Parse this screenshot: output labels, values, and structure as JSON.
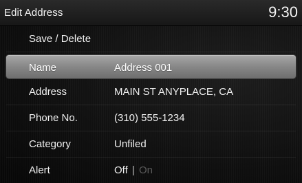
{
  "header": {
    "title": "Edit Address",
    "clock": "9:30"
  },
  "menu": {
    "save_delete": "Save / Delete",
    "rows": [
      {
        "label": "Name",
        "value": "Address 001"
      },
      {
        "label": "Address",
        "value": "MAIN ST ANYPLACE, CA"
      },
      {
        "label": "Phone No.",
        "value": "(310) 555-1234"
      },
      {
        "label": "Category",
        "value": "Unfiled"
      }
    ],
    "alert": {
      "label": "Alert",
      "off": "Off",
      "separator": "|",
      "on": "On"
    }
  },
  "colors": {
    "selected_row": "#8a8a8a",
    "inactive_option": "#5a5a5a"
  }
}
